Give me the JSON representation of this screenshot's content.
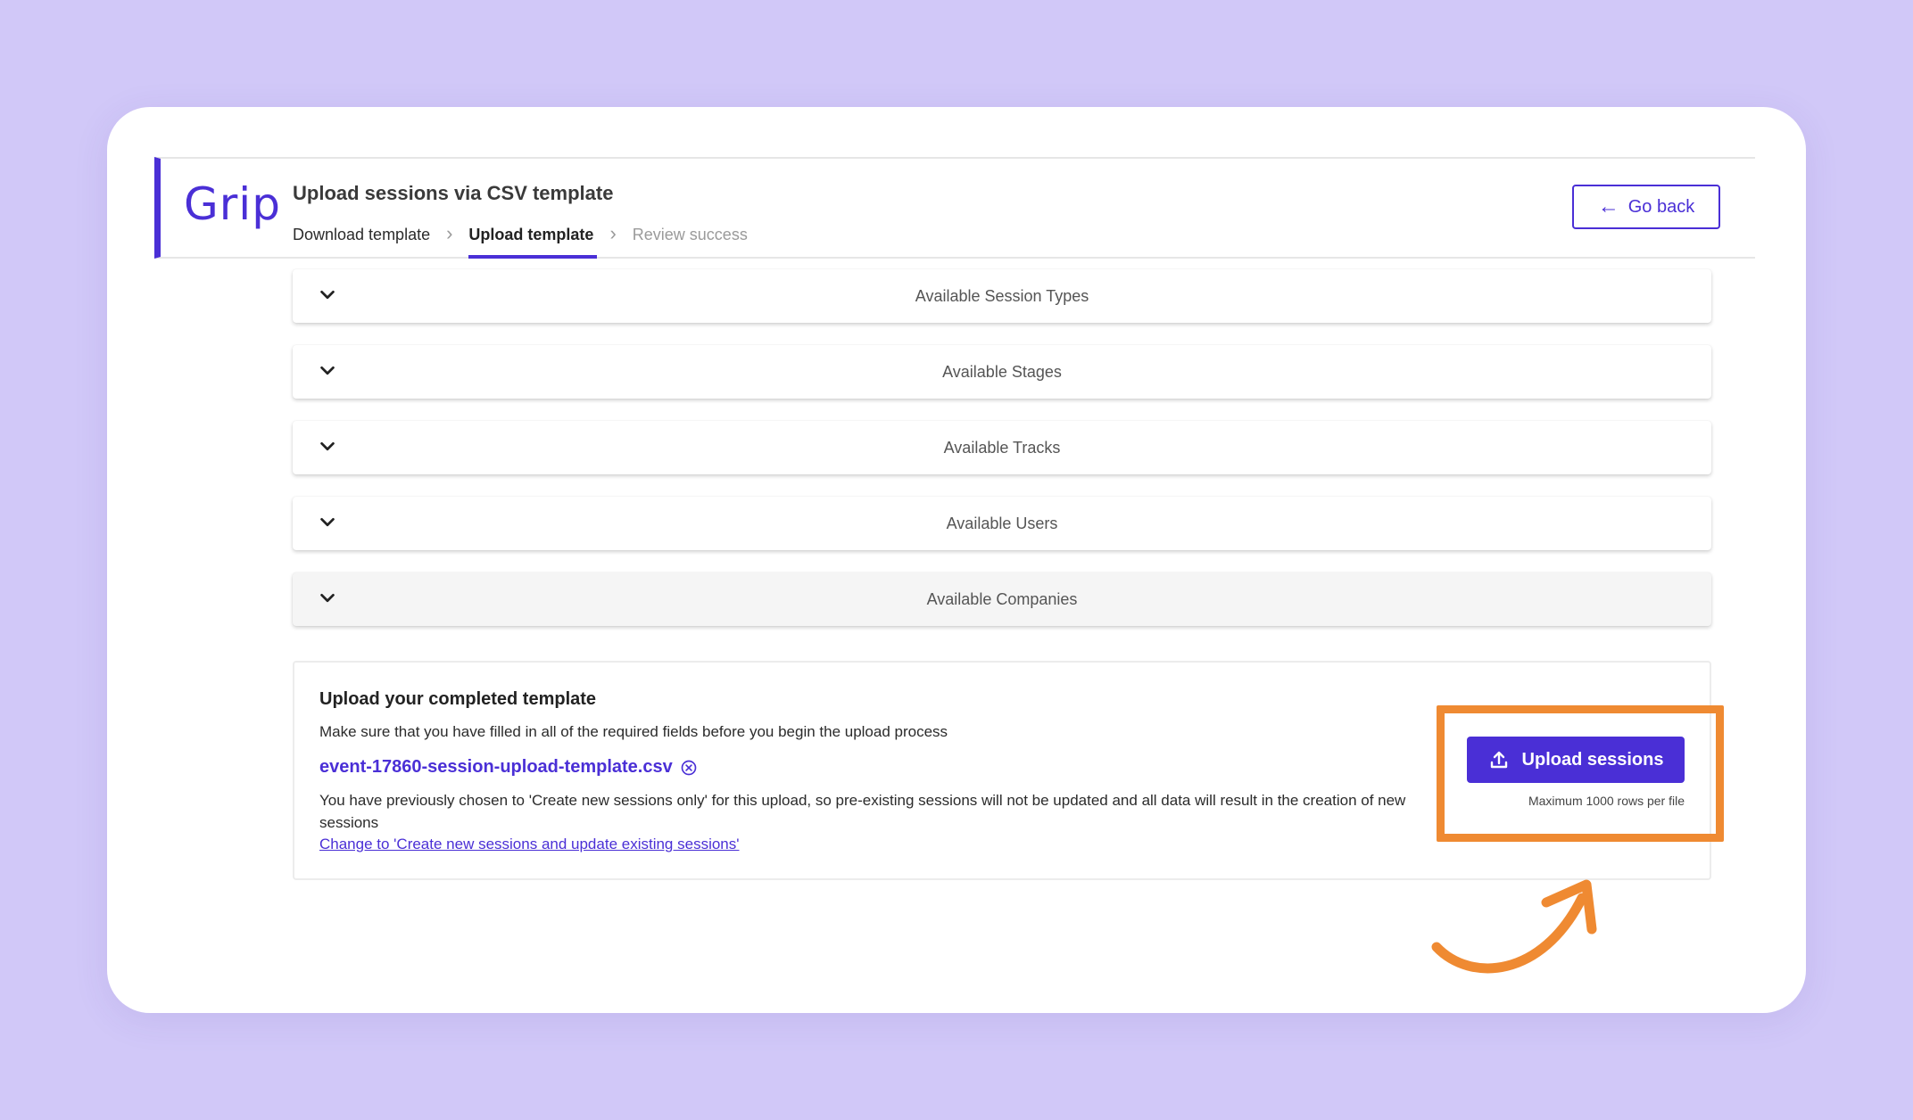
{
  "header": {
    "logo_text": "Grip",
    "title": "Upload sessions via CSV template",
    "breadcrumb": [
      {
        "label": "Download template",
        "state": "done"
      },
      {
        "label": "Upload template",
        "state": "active"
      },
      {
        "label": "Review success",
        "state": "disabled"
      }
    ],
    "go_back_label": "Go back"
  },
  "accordions": [
    {
      "label": "Available Session Types"
    },
    {
      "label": "Available Stages"
    },
    {
      "label": "Available Tracks"
    },
    {
      "label": "Available Users"
    },
    {
      "label": "Available Companies"
    }
  ],
  "upload": {
    "title": "Upload your completed template",
    "description": "Make sure that you have filled in all of the required fields before you begin the upload process",
    "file_name": "event-17860-session-upload-template.csv",
    "notice": "You have previously chosen to 'Create new sessions only' for this upload, so pre-existing sessions will not be updated and all data will result in the creation of new sessions",
    "change_link": "Change to 'Create new sessions and update existing sessions'",
    "button_label": "Upload sessions",
    "max_rows": "Maximum 1000 rows per file"
  },
  "colors": {
    "brand": "#4a2fd6",
    "highlight": "#ef8a32",
    "background": "#d1c8f8"
  },
  "icons": {
    "back": "arrow-left-icon",
    "expand": "chevron-down-icon",
    "remove": "close-circle-icon",
    "upload": "upload-icon",
    "annotation": "curved-arrow-icon"
  }
}
